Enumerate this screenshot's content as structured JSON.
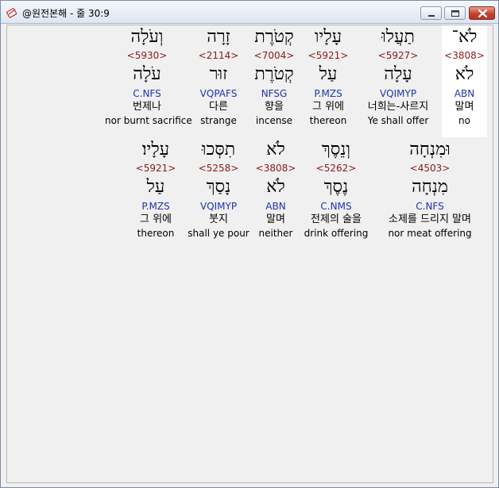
{
  "window": {
    "title": "@원전본해 - 줄 30:9",
    "icon": "app-icon",
    "minimize_icon": "minimize-icon",
    "maximize_icon": "maximize-icon",
    "close_icon": "close-icon"
  },
  "rows": [
    {
      "words": [
        {
          "hebrew": "וְעֹלָה",
          "strong": "<5930>",
          "lemma": "עֹלָה",
          "morph": "C.NFS",
          "korean": "번제나",
          "english": "nor burnt sacrifice"
        },
        {
          "hebrew": "זָרָה",
          "strong": "<2114>",
          "lemma": "זוּר",
          "morph": "VQPAFS",
          "korean": "다른",
          "english": "strange"
        },
        {
          "hebrew": "קְטֹרֶת",
          "strong": "<7004>",
          "lemma": "קְטֹרֶת",
          "morph": "NFSG",
          "korean": "향을",
          "english": "incense"
        },
        {
          "hebrew": "עָלָיו",
          "strong": "<5921>",
          "lemma": "עַל",
          "morph": "P.MZS",
          "korean": "그 위에",
          "english": "thereon"
        },
        {
          "hebrew": "תַעֲלוּ",
          "strong": "<5927>",
          "lemma": "עָלָה",
          "morph": "VQIMYP",
          "korean": "너희는-사르지",
          "english": "Ye shall offer"
        },
        {
          "hebrew": "לֹא־",
          "strong": "<3808>",
          "lemma": "לֹא",
          "morph": "ABN",
          "korean": "말며",
          "english": "no",
          "highlighted": true
        }
      ]
    },
    {
      "words": [
        {
          "hebrew": "עָלָיו׃",
          "strong": "<5921>",
          "lemma": "עַל",
          "morph": "P.MZS",
          "korean": "그 위에",
          "english": "thereon"
        },
        {
          "hebrew": "תִסְּכוּ",
          "strong": "<5258>",
          "lemma": "נָסַךְ",
          "morph": "VQIMYP",
          "korean": "붓지",
          "english": "shall ye pour"
        },
        {
          "hebrew": "לֹא",
          "strong": "<3808>",
          "lemma": "לֹא",
          "morph": "ABN",
          "korean": "말며",
          "english": "neither"
        },
        {
          "hebrew": "וְנֵסֶךְ",
          "strong": "<5262>",
          "lemma": "נֶסֶךְ",
          "morph": "C.NMS",
          "korean": "전제의 술을",
          "english": "drink offering"
        },
        {
          "hebrew": "וּמִנְחָה",
          "strong": "<4503>",
          "lemma": "מִנְחָה",
          "morph": "C.NFS",
          "korean": "소제를 드리지 말며",
          "english": "nor meat offering"
        }
      ]
    }
  ]
}
